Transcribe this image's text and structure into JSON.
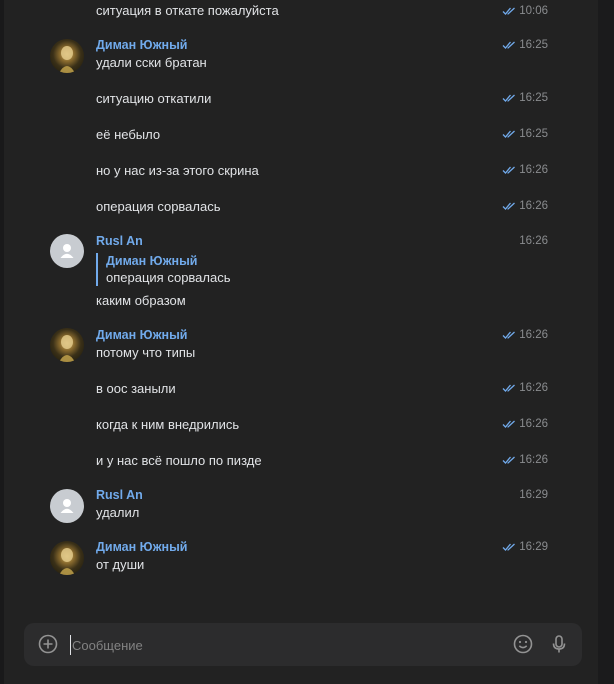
{
  "messages": [
    {
      "author": "",
      "text": "ситуация в откате пожалуйста",
      "time": "10:06",
      "read": true
    },
    {
      "author": "Диман Южный",
      "text": "удали сски братан",
      "time": "16:25",
      "read": true
    },
    {
      "author": "",
      "text": "ситуацию откатили",
      "time": "16:25",
      "read": true
    },
    {
      "author": "",
      "text": "её небыло",
      "time": "16:25",
      "read": true
    },
    {
      "author": "",
      "text": "но у нас из-за этого скрина",
      "time": "16:26",
      "read": true
    },
    {
      "author": "",
      "text": "операция сорвалась",
      "time": "16:26",
      "read": true
    },
    {
      "author": "Rusl An",
      "reply_author": "Диман Южный",
      "reply_text": "операция сорвалась",
      "text": "каким образом",
      "time": "16:26",
      "read": false
    },
    {
      "author": "Диман Южный",
      "text": "потому что типы",
      "time": "16:26",
      "read": true
    },
    {
      "author": "",
      "text": "в оос заныли",
      "time": "16:26",
      "read": true
    },
    {
      "author": "",
      "text": "когда к ним внедрились",
      "time": "16:26",
      "read": true
    },
    {
      "author": "",
      "text": "и у нас всё пошло по пизде",
      "time": "16:26",
      "read": true
    },
    {
      "author": "Rusl An",
      "text": "удалил",
      "time": "16:29",
      "read": false
    },
    {
      "author": "Диман Южный",
      "text": "от души",
      "time": "16:29",
      "read": true
    }
  ],
  "composer": {
    "placeholder": "Сообщение",
    "attach_icon": "add-circle-icon",
    "emoji_icon": "emoji-smile-icon",
    "voice_icon": "microphone-icon"
  },
  "colors": {
    "background": "#222222",
    "author": "#71aaeb",
    "text": "#e1e3e6",
    "time": "#8a8c8f",
    "check": "#71aaeb",
    "composer_bg": "#2c2c2d"
  }
}
